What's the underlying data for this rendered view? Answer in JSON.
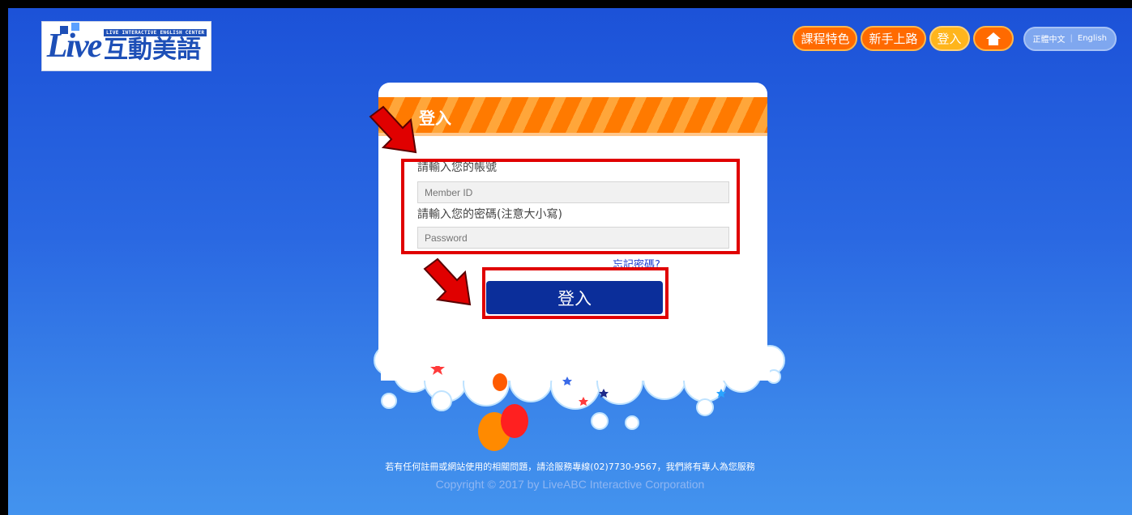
{
  "logo": {
    "subtitle": "LIVE INTERACTIVE ENGLISH CENTER",
    "brand_mark": "Live",
    "title": "互動美語"
  },
  "nav": {
    "features": "課程特色",
    "beginner": "新手上路",
    "login": "登入",
    "home_icon": "home-icon",
    "lang_zh": "正體中文",
    "lang_en": "English"
  },
  "login": {
    "title": "登入",
    "account_label": "請輸入您的帳號",
    "account_placeholder": "Member ID",
    "password_label": "請輸入您的密碼(注意大小寫)",
    "password_placeholder": "Password",
    "forgot": "忘記密碼?",
    "submit": "登入"
  },
  "footer": {
    "note": "若有任何註冊或網站使用的相關問題，請洽服務專線(02)7730-9567，我們將有專人為您服務",
    "copyright": "Copyright © 2017 by LiveABC Interactive Corporation"
  },
  "colors": {
    "accent_orange": "#ff6a00",
    "active_yellow": "#ffb51c",
    "button_navy": "#0b2e9a",
    "highlight_red": "#e00000"
  }
}
